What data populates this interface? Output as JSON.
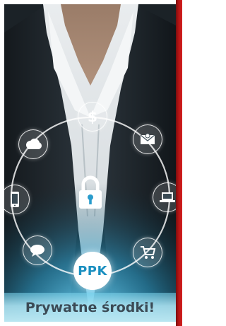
{
  "badge": {
    "label": "PPK"
  },
  "banner": {
    "text": "Prywatne środki!"
  },
  "icons": [
    "dollar-icon",
    "email-icon",
    "laptop-icon",
    "shopping-cart-icon",
    "chat-bubble-icon",
    "mobile-phone-icon",
    "cloud-icon",
    "padlock-icon"
  ],
  "colors": {
    "border": "#c51a1a",
    "badge_text": "#1a8fc0",
    "banner_text": "#3b4a55",
    "banner_bg": "#b9e6f1"
  }
}
